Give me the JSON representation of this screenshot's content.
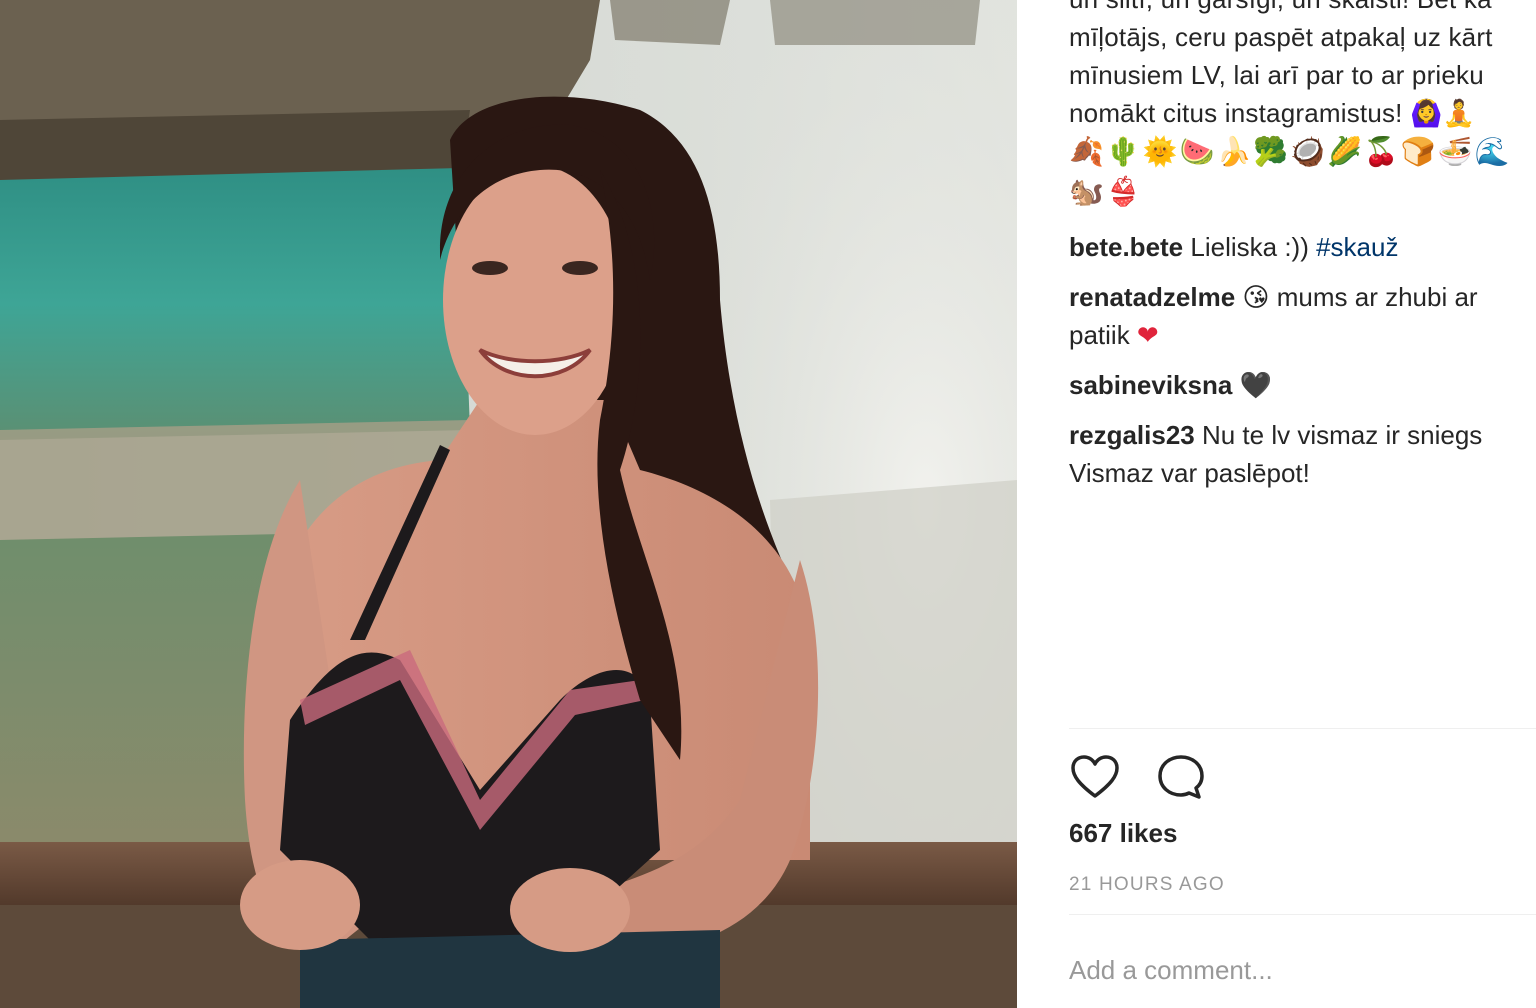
{
  "post": {
    "caption_lines": [
      "un siltī, un garšīgi, un skaisti! Bet kā",
      "mīļotājs, ceru paspēt atpakaļ uz kārt",
      "mīnusiem LV, lai arī par to ar prieku",
      "nomākt citus instagramistus! 🙆‍♀️🧘"
    ],
    "caption_emoji_line_1": "🍂🌵🌞🍉🍌🥦🥥🌽🍒🍞🍜🌊",
    "caption_emoji_line_2": "🐿️👙"
  },
  "comments": [
    {
      "user": "bete.bete",
      "text": " Lieliska :)) ",
      "tag": "#skauž",
      "line2": ""
    },
    {
      "user": "renatadzelme",
      "text": " 😘 mums ar zhubi ar",
      "tag": "",
      "line2": "patiik ",
      "heart": "❤"
    },
    {
      "user": "sabineviksna",
      "text": " ",
      "tag": "",
      "line2": "",
      "heart": "🖤"
    },
    {
      "user": "rezgalis23",
      "text": " Nu te lv vismaz ir sniegs",
      "tag": "",
      "line2": "Vismaz var paslēpot!"
    }
  ],
  "likes_text": "667 likes",
  "timestamp": "21 HOURS AGO",
  "add_comment_placeholder": "Add a comment...",
  "icons": {
    "like": "heart-outline-icon",
    "comment": "speech-bubble-icon"
  },
  "colors": {
    "text": "#262626",
    "muted": "#999999",
    "hashtag": "#003569",
    "divider": "#efefef"
  }
}
